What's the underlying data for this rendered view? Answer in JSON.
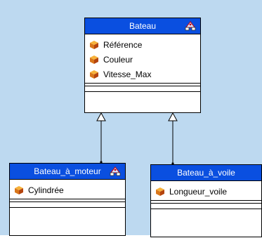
{
  "background_color": "#bdd9f0",
  "header_color": "#0a4fe0",
  "classes": {
    "bateau": {
      "name": "Bateau",
      "icon": "stereotype-icon",
      "attributes": [
        "Référence",
        "Couleur",
        "Vitesse_Max"
      ]
    },
    "moteur": {
      "name": "Bateau_à_moteur",
      "icon": "stereotype-icon",
      "attributes": [
        "Cylindrée"
      ]
    },
    "voile": {
      "name": "Bateau_à_voile",
      "attributes": [
        "Longueur_voile"
      ]
    }
  },
  "relations": [
    {
      "type": "generalization",
      "from": "Bateau_à_moteur",
      "to": "Bateau"
    },
    {
      "type": "generalization",
      "from": "Bateau_à_voile",
      "to": "Bateau"
    }
  ]
}
